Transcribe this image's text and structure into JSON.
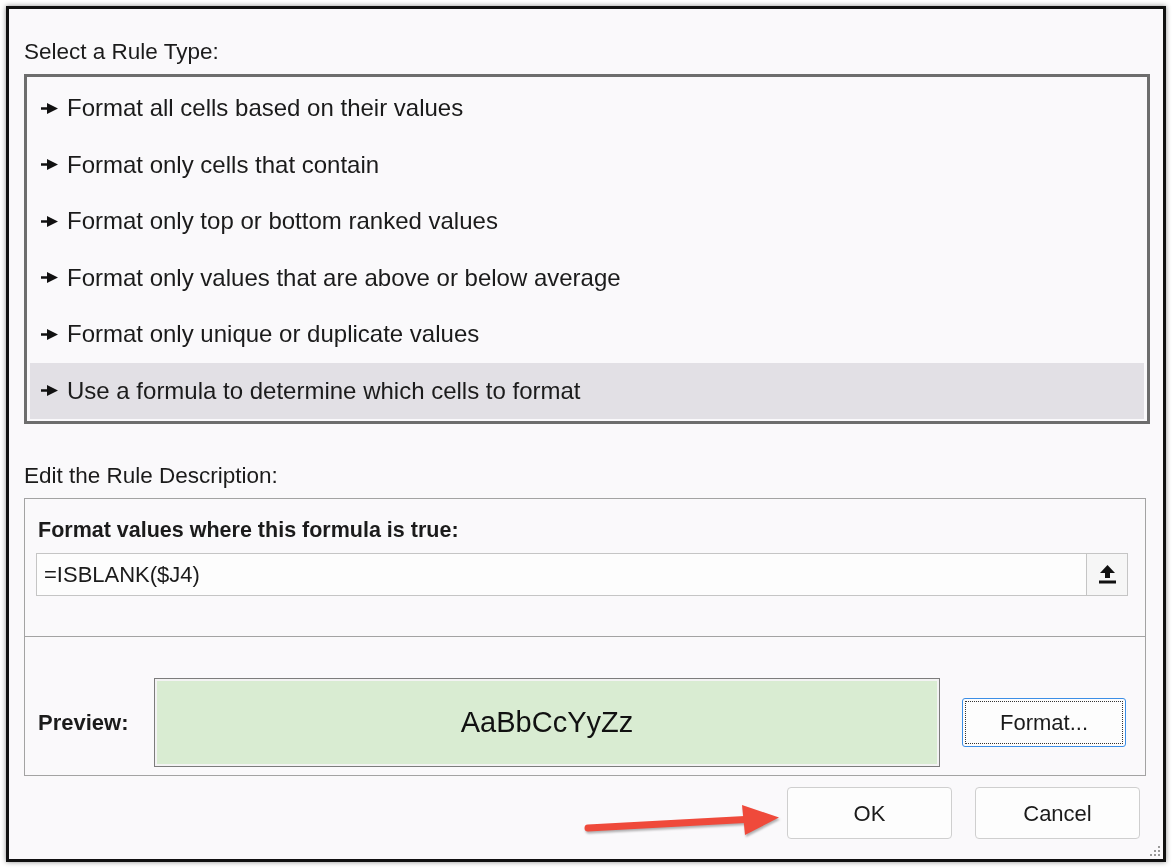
{
  "dialog": {
    "rule_type_label": "Select a Rule Type:",
    "rule_types": [
      {
        "label": "Format all cells based on their values",
        "selected": false
      },
      {
        "label": "Format only cells that contain",
        "selected": false
      },
      {
        "label": "Format only top or bottom ranked values",
        "selected": false
      },
      {
        "label": "Format only values that are above or below average",
        "selected": false
      },
      {
        "label": "Format only unique or duplicate values",
        "selected": false
      },
      {
        "label": "Use a formula to determine which cells to format",
        "selected": true
      }
    ],
    "description_label": "Edit the Rule Description:",
    "description": {
      "formula_label": "Format values where this formula is true:",
      "formula": {
        "value": "=ISBLANK($J4)"
      },
      "preview_label": "Preview:",
      "preview_sample": "AaBbCcYyZz",
      "format_button": {
        "label": "Format...",
        "focused": true
      }
    },
    "buttons": [
      {
        "label": "OK",
        "focused": false
      },
      {
        "label": "Cancel",
        "focused": false
      }
    ]
  }
}
